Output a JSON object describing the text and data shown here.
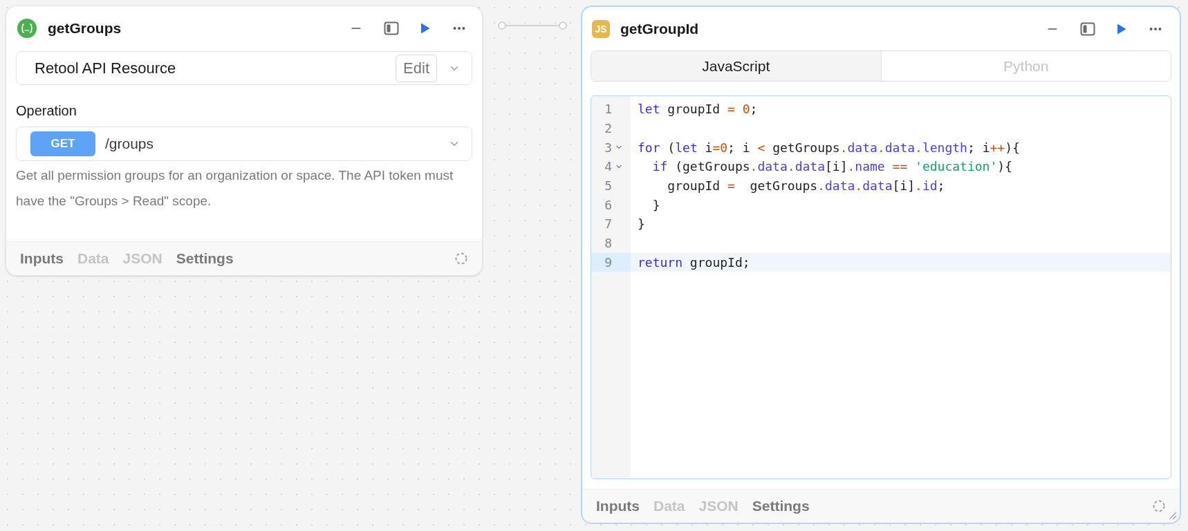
{
  "query_block": {
    "title": "getGroups",
    "resource": {
      "value": "Retool API Resource",
      "edit_label": "Edit"
    },
    "operation": {
      "label": "Operation",
      "method": "GET",
      "path": "/groups"
    },
    "description": "Get all permission groups for an organization or space. The API token must have the \"Groups > Read\" scope.",
    "footer_tabs": [
      {
        "label": "Inputs",
        "disabled": false
      },
      {
        "label": "Data",
        "disabled": true
      },
      {
        "label": "JSON",
        "disabled": true
      },
      {
        "label": "Settings",
        "disabled": false
      }
    ]
  },
  "code_block": {
    "badge": "JS",
    "title": "getGroupId",
    "language_tabs": [
      {
        "label": "JavaScript",
        "selected": true
      },
      {
        "label": "Python",
        "selected": false
      }
    ],
    "lines": [
      {
        "number": "1",
        "foldable": false,
        "active": false,
        "tokens": [
          {
            "kind": "keyword",
            "text": "let"
          },
          {
            "kind": "plain",
            "text": " groupId "
          },
          {
            "kind": "operator",
            "text": "= "
          },
          {
            "kind": "number",
            "text": "0"
          },
          {
            "kind": "plain",
            "text": ";"
          }
        ]
      },
      {
        "number": "2",
        "foldable": false,
        "active": false
      },
      {
        "number": "3",
        "foldable": true,
        "active": false,
        "tokens": [
          {
            "kind": "keyword",
            "text": "for"
          },
          {
            "kind": "plain",
            "text": " ("
          },
          {
            "kind": "keyword",
            "text": "let"
          },
          {
            "kind": "plain",
            "text": " i"
          },
          {
            "kind": "operator",
            "text": "="
          },
          {
            "kind": "number",
            "text": "0"
          },
          {
            "kind": "plain",
            "text": "; i "
          },
          {
            "kind": "operator",
            "text": "<"
          },
          {
            "kind": "plain",
            "text": " getGroups"
          },
          {
            "kind": "operator",
            "text": "."
          },
          {
            "kind": "property",
            "text": "data"
          },
          {
            "kind": "operator",
            "text": "."
          },
          {
            "kind": "property",
            "text": "data"
          },
          {
            "kind": "operator",
            "text": "."
          },
          {
            "kind": "property",
            "text": "length"
          },
          {
            "kind": "plain",
            "text": "; i"
          },
          {
            "kind": "operator",
            "text": "++"
          },
          {
            "kind": "plain",
            "text": "){"
          }
        ]
      },
      {
        "number": "4",
        "foldable": true,
        "active": false,
        "tokens": [
          {
            "kind": "keyword",
            "text": "  if"
          },
          {
            "kind": "plain",
            "text": " (getGroups"
          },
          {
            "kind": "operator",
            "text": "."
          },
          {
            "kind": "property",
            "text": "data"
          },
          {
            "kind": "operator",
            "text": "."
          },
          {
            "kind": "property",
            "text": "data"
          },
          {
            "kind": "plain",
            "text": "[i]"
          },
          {
            "kind": "operator",
            "text": "."
          },
          {
            "kind": "property",
            "text": "name"
          },
          {
            "kind": "operator",
            "text": " == "
          },
          {
            "kind": "string",
            "text": "'education'"
          },
          {
            "kind": "plain",
            "text": "){"
          }
        ]
      },
      {
        "number": "5",
        "foldable": false,
        "active": false,
        "tokens": [
          {
            "kind": "plain",
            "text": "    groupId "
          },
          {
            "kind": "operator",
            "text": "="
          },
          {
            "kind": "plain",
            "text": "  getGroups"
          },
          {
            "kind": "operator",
            "text": "."
          },
          {
            "kind": "property",
            "text": "data"
          },
          {
            "kind": "operator",
            "text": "."
          },
          {
            "kind": "property",
            "text": "data"
          },
          {
            "kind": "plain",
            "text": "[i]"
          },
          {
            "kind": "operator",
            "text": "."
          },
          {
            "kind": "property",
            "text": "id"
          },
          {
            "kind": "plain",
            "text": ";"
          }
        ]
      },
      {
        "number": "6",
        "foldable": false,
        "active": false,
        "tokens": [
          {
            "kind": "plain",
            "text": "  }"
          }
        ]
      },
      {
        "number": "7",
        "foldable": false,
        "active": false,
        "tokens": [
          {
            "kind": "plain",
            "text": "}"
          }
        ]
      },
      {
        "number": "8",
        "foldable": false,
        "active": false
      },
      {
        "number": "9",
        "foldable": false,
        "active": true,
        "tokens": [
          {
            "kind": "keyword",
            "text": "return"
          },
          {
            "kind": "plain",
            "text": " groupId;"
          }
        ]
      }
    ],
    "footer_tabs": [
      {
        "label": "Inputs",
        "disabled": false
      },
      {
        "label": "Data",
        "disabled": true
      },
      {
        "label": "JSON",
        "disabled": true
      },
      {
        "label": "Settings",
        "disabled": false
      }
    ]
  }
}
